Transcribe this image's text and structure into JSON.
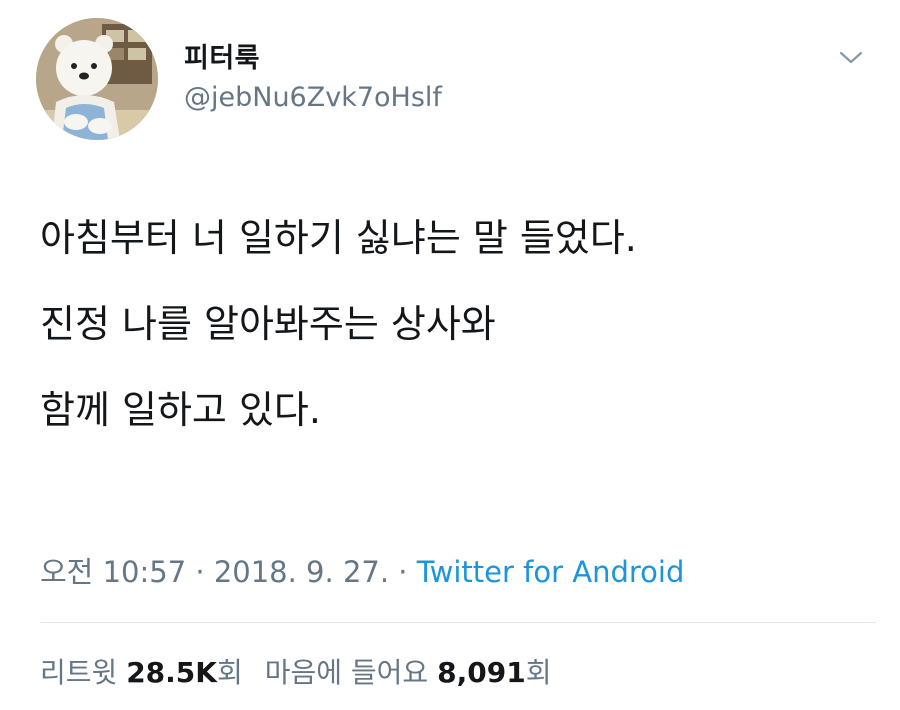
{
  "user": {
    "display_name": "피터룩",
    "handle": "@jebNu6Zvk7oHslf",
    "avatar_icon": "polar-bear-avatar"
  },
  "menu_icon": "chevron-down-icon",
  "tweet": {
    "lines": [
      "아침부터 너 일하기 싫냐는 말 들었다.",
      "진정 나를 알아봐주는 상사와",
      "함께 일하고 있다."
    ]
  },
  "meta": {
    "time": "오전 10:57",
    "sep1": " · ",
    "date": "2018. 9. 27.",
    "sep2": " · ",
    "source": "Twitter for Android"
  },
  "stats": {
    "retweet_label": "리트윗",
    "retweet_count": "28.5K",
    "retweet_unit": "회",
    "like_label": "마음에 들어요",
    "like_count": "8,091",
    "like_unit": "회"
  },
  "colors": {
    "text": "#14171a",
    "secondary": "#657786",
    "link": "#1b95e0",
    "divider": "#e1e8ed"
  }
}
